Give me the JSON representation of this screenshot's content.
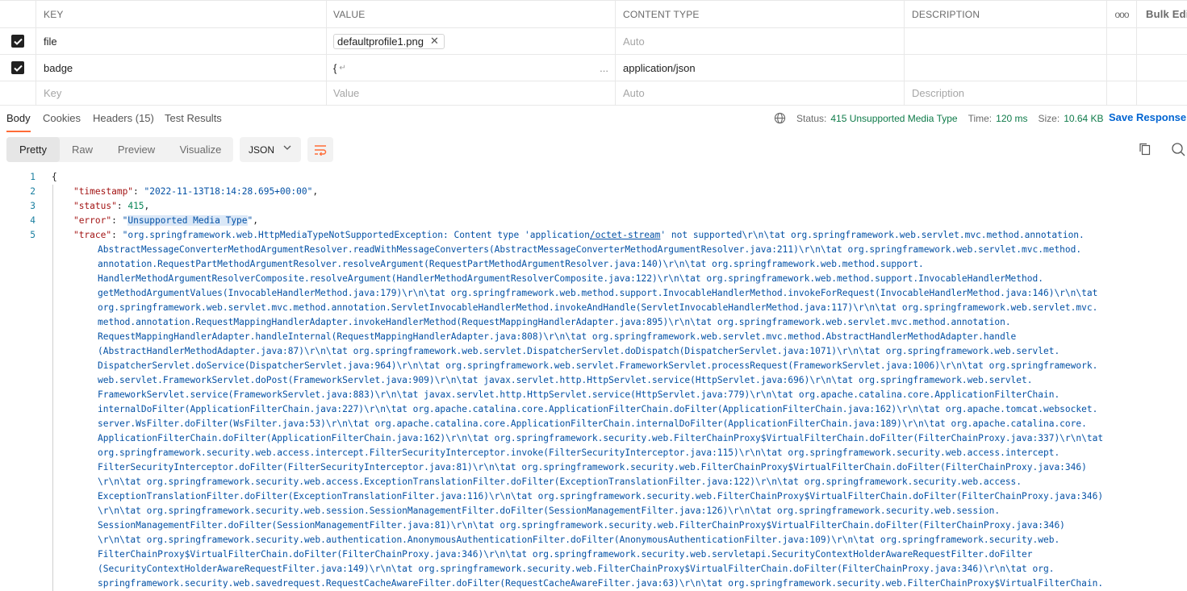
{
  "table": {
    "headers": {
      "key": "KEY",
      "value": "VALUE",
      "content_type": "CONTENT TYPE",
      "description": "DESCRIPTION",
      "more": "ooo",
      "bulk_edit": "Bulk Edit"
    },
    "rows": [
      {
        "key": "file",
        "value": "defaultprofile1.png",
        "content_type_placeholder": "Auto",
        "description": ""
      },
      {
        "key": "badge",
        "value_preview": "{",
        "value_more": "...",
        "content_type": "application/json",
        "description": ""
      }
    ],
    "new_row": {
      "key_placeholder": "Key",
      "value_placeholder": "Value",
      "content_type_placeholder": "Auto",
      "description_placeholder": "Description"
    }
  },
  "response": {
    "tabs": [
      "Body",
      "Cookies",
      "Headers (15)",
      "Test Results"
    ],
    "status_label": "Status:",
    "status_value": "415 Unsupported Media Type",
    "time_label": "Time:",
    "time_value": "120 ms",
    "size_label": "Size:",
    "size_value": "10.64 KB",
    "save_response": "Save Response"
  },
  "viewer": {
    "modes": [
      "Pretty",
      "Raw",
      "Preview",
      "Visualize"
    ],
    "format": "JSON"
  },
  "code": {
    "line_numbers": [
      "1",
      "2",
      "3",
      "4",
      "5"
    ],
    "line1": "{",
    "timestamp_key": "\"timestamp\"",
    "timestamp_val": "\"2022-11-13T18:14:28.695+00:00\"",
    "status_key": "\"status\"",
    "status_val": "415",
    "error_key": "\"error\"",
    "error_val_open": "\"",
    "error_val": "Unsupported Media Type",
    "error_val_close": "\"",
    "trace_key": "\"trace\"",
    "trace_first_a": "\"org.springframework.web.HttpMediaTypeNotSupportedException: Content type 'application",
    "trace_first_b": "/octet-stream",
    "trace_first_c": "' not supported\\r\\n\\tat org.springframework.web.servlet.mvc.method.annotation.",
    "trace_cont": [
      "AbstractMessageConverterMethodArgumentResolver.readWithMessageConverters(AbstractMessageConverterMethodArgumentResolver.java:211)\\r\\n\\tat org.springframework.web.servlet.mvc.method.",
      "annotation.RequestPartMethodArgumentResolver.resolveArgument(RequestPartMethodArgumentResolver.java:140)\\r\\n\\tat org.springframework.web.method.support.",
      "HandlerMethodArgumentResolverComposite.resolveArgument(HandlerMethodArgumentResolverComposite.java:122)\\r\\n\\tat org.springframework.web.method.support.InvocableHandlerMethod.",
      "getMethodArgumentValues(InvocableHandlerMethod.java:179)\\r\\n\\tat org.springframework.web.method.support.InvocableHandlerMethod.invokeForRequest(InvocableHandlerMethod.java:146)\\r\\n\\tat",
      "org.springframework.web.servlet.mvc.method.annotation.ServletInvocableHandlerMethod.invokeAndHandle(ServletInvocableHandlerMethod.java:117)\\r\\n\\tat org.springframework.web.servlet.mvc.",
      "method.annotation.RequestMappingHandlerAdapter.invokeHandlerMethod(RequestMappingHandlerAdapter.java:895)\\r\\n\\tat org.springframework.web.servlet.mvc.method.annotation.",
      "RequestMappingHandlerAdapter.handleInternal(RequestMappingHandlerAdapter.java:808)\\r\\n\\tat org.springframework.web.servlet.mvc.method.AbstractHandlerMethodAdapter.handle",
      "(AbstractHandlerMethodAdapter.java:87)\\r\\n\\tat org.springframework.web.servlet.DispatcherServlet.doDispatch(DispatcherServlet.java:1071)\\r\\n\\tat org.springframework.web.servlet.",
      "DispatcherServlet.doService(DispatcherServlet.java:964)\\r\\n\\tat org.springframework.web.servlet.FrameworkServlet.processRequest(FrameworkServlet.java:1006)\\r\\n\\tat org.springframework.",
      "web.servlet.FrameworkServlet.doPost(FrameworkServlet.java:909)\\r\\n\\tat javax.servlet.http.HttpServlet.service(HttpServlet.java:696)\\r\\n\\tat org.springframework.web.servlet.",
      "FrameworkServlet.service(FrameworkServlet.java:883)\\r\\n\\tat javax.servlet.http.HttpServlet.service(HttpServlet.java:779)\\r\\n\\tat org.apache.catalina.core.ApplicationFilterChain.",
      "internalDoFilter(ApplicationFilterChain.java:227)\\r\\n\\tat org.apache.catalina.core.ApplicationFilterChain.doFilter(ApplicationFilterChain.java:162)\\r\\n\\tat org.apache.tomcat.websocket.",
      "server.WsFilter.doFilter(WsFilter.java:53)\\r\\n\\tat org.apache.catalina.core.ApplicationFilterChain.internalDoFilter(ApplicationFilterChain.java:189)\\r\\n\\tat org.apache.catalina.core.",
      "ApplicationFilterChain.doFilter(ApplicationFilterChain.java:162)\\r\\n\\tat org.springframework.security.web.FilterChainProxy$VirtualFilterChain.doFilter(FilterChainProxy.java:337)\\r\\n\\tat",
      "org.springframework.security.web.access.intercept.FilterSecurityInterceptor.invoke(FilterSecurityInterceptor.java:115)\\r\\n\\tat org.springframework.security.web.access.intercept.",
      "FilterSecurityInterceptor.doFilter(FilterSecurityInterceptor.java:81)\\r\\n\\tat org.springframework.security.web.FilterChainProxy$VirtualFilterChain.doFilter(FilterChainProxy.java:346)",
      "\\r\\n\\tat org.springframework.security.web.access.ExceptionTranslationFilter.doFilter(ExceptionTranslationFilter.java:122)\\r\\n\\tat org.springframework.security.web.access.",
      "ExceptionTranslationFilter.doFilter(ExceptionTranslationFilter.java:116)\\r\\n\\tat org.springframework.security.web.FilterChainProxy$VirtualFilterChain.doFilter(FilterChainProxy.java:346)",
      "\\r\\n\\tat org.springframework.security.web.session.SessionManagementFilter.doFilter(SessionManagementFilter.java:126)\\r\\n\\tat org.springframework.security.web.session.",
      "SessionManagementFilter.doFilter(SessionManagementFilter.java:81)\\r\\n\\tat org.springframework.security.web.FilterChainProxy$VirtualFilterChain.doFilter(FilterChainProxy.java:346)",
      "\\r\\n\\tat org.springframework.security.web.authentication.AnonymousAuthenticationFilter.doFilter(AnonymousAuthenticationFilter.java:109)\\r\\n\\tat org.springframework.security.web.",
      "FilterChainProxy$VirtualFilterChain.doFilter(FilterChainProxy.java:346)\\r\\n\\tat org.springframework.security.web.servletapi.SecurityContextHolderAwareRequestFilter.doFilter",
      "(SecurityContextHolderAwareRequestFilter.java:149)\\r\\n\\tat org.springframework.security.web.FilterChainProxy$VirtualFilterChain.doFilter(FilterChainProxy.java:346)\\r\\n\\tat org.",
      "springframework.security.web.savedrequest.RequestCacheAwareFilter.doFilter(RequestCacheAwareFilter.java:63)\\r\\n\\tat org.springframework.security.web.FilterChainProxy$VirtualFilterChain."
    ]
  },
  "colors": {
    "accent": "#ff6c37",
    "link": "#0265d2",
    "status_ok": "#0f7b4a",
    "json_key": "#a31515",
    "json_string": "#0451a5",
    "json_number": "#098658"
  },
  "icons": [
    "checkbox-checked-icon",
    "close-icon",
    "globe-icon",
    "chevron-down-icon",
    "wrap-lines-icon",
    "copy-icon",
    "search-icon"
  ]
}
